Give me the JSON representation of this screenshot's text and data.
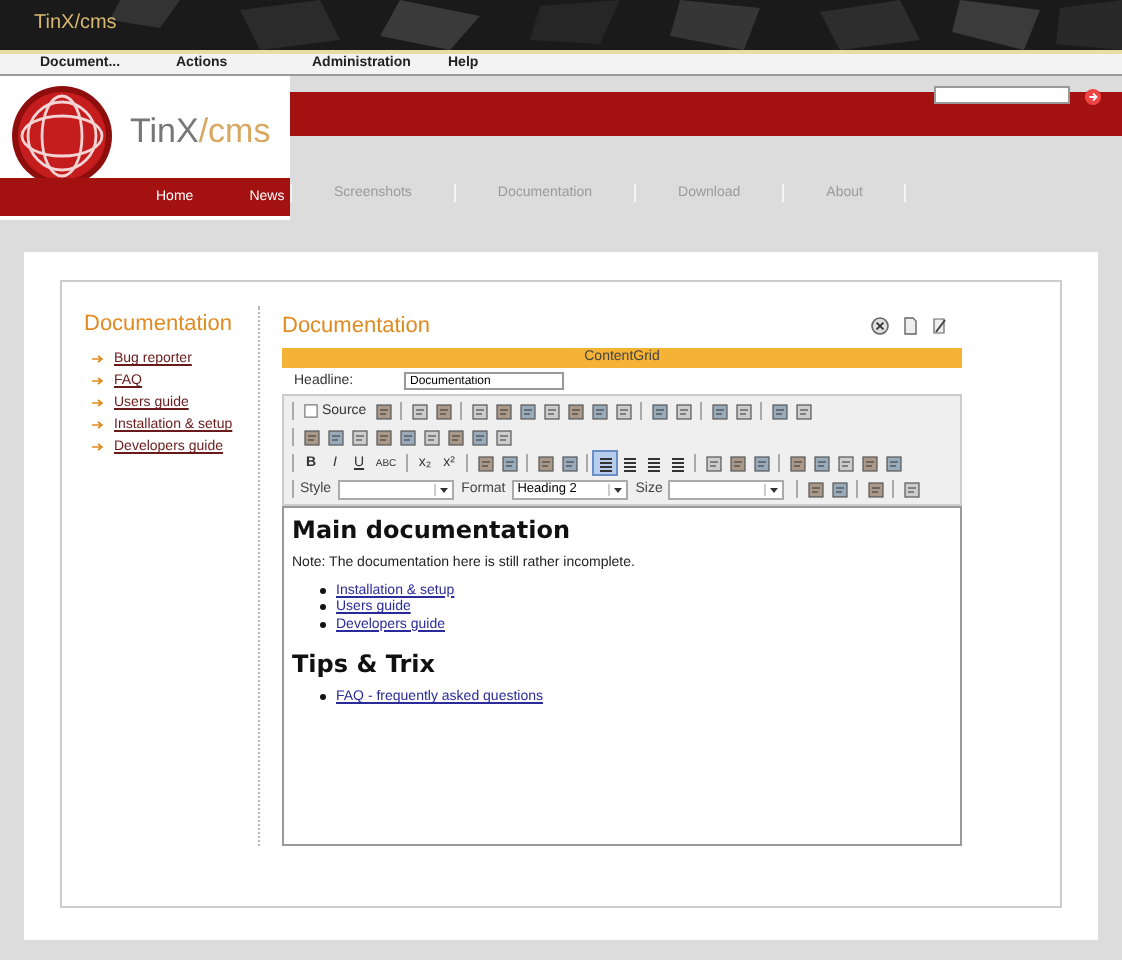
{
  "banner": {
    "title_a": "TinX",
    "title_b": "/cms"
  },
  "menu": [
    "Document...",
    "Actions",
    "Administration",
    "Help"
  ],
  "logo": {
    "text_a": "TinX",
    "text_b": "/cms"
  },
  "nav_left": [
    "Home",
    "News"
  ],
  "nav_right": [
    "Screenshots",
    "Documentation",
    "Download",
    "About"
  ],
  "sidebar": {
    "title": "Documentation",
    "links": [
      "Bug reporter",
      "FAQ",
      "Users guide",
      "Installation & setup",
      "Developers guide"
    ]
  },
  "main": {
    "title": "Documentation",
    "grid_title": "ContentGrid",
    "headline_label": "Headline:",
    "headline_value": "Documentation",
    "toolbar": [
      [
        {
          "kind": "sep"
        },
        {
          "kind": "text",
          "label": "Source"
        },
        {
          "kind": "icon"
        },
        {
          "kind": "sep"
        },
        {
          "kind": "icon"
        },
        {
          "kind": "icon"
        },
        {
          "kind": "sep"
        },
        {
          "kind": "icon"
        },
        {
          "kind": "icon"
        },
        {
          "kind": "icon"
        },
        {
          "kind": "icon"
        },
        {
          "kind": "icon"
        },
        {
          "kind": "icon"
        },
        {
          "kind": "icon"
        },
        {
          "kind": "sep"
        },
        {
          "kind": "icon"
        },
        {
          "kind": "icon"
        },
        {
          "kind": "sep"
        },
        {
          "kind": "icon"
        },
        {
          "kind": "icon"
        },
        {
          "kind": "sep"
        },
        {
          "kind": "icon"
        },
        {
          "kind": "icon"
        }
      ],
      [
        {
          "kind": "sep"
        },
        {
          "kind": "icon"
        },
        {
          "kind": "icon"
        },
        {
          "kind": "icon"
        },
        {
          "kind": "icon"
        },
        {
          "kind": "icon"
        },
        {
          "kind": "icon"
        },
        {
          "kind": "icon"
        },
        {
          "kind": "icon"
        },
        {
          "kind": "icon"
        }
      ],
      [
        {
          "kind": "sep"
        },
        {
          "kind": "bold",
          "label": "B"
        },
        {
          "kind": "italic",
          "label": "I"
        },
        {
          "kind": "underline",
          "label": "U"
        },
        {
          "kind": "strike",
          "label": "ABC"
        },
        {
          "kind": "sep"
        },
        {
          "kind": "plain",
          "label": "x₂"
        },
        {
          "kind": "plain",
          "label": "x²"
        },
        {
          "kind": "sep"
        },
        {
          "kind": "icon"
        },
        {
          "kind": "icon"
        },
        {
          "kind": "sep"
        },
        {
          "kind": "icon"
        },
        {
          "kind": "icon"
        },
        {
          "kind": "sep"
        },
        {
          "kind": "align",
          "selected": true
        },
        {
          "kind": "align",
          "selected": false
        },
        {
          "kind": "align",
          "selected": false
        },
        {
          "kind": "align",
          "selected": false
        },
        {
          "kind": "sep"
        },
        {
          "kind": "icon"
        },
        {
          "kind": "icon"
        },
        {
          "kind": "icon"
        },
        {
          "kind": "sep"
        },
        {
          "kind": "icon"
        },
        {
          "kind": "icon"
        },
        {
          "kind": "icon"
        },
        {
          "kind": "icon"
        },
        {
          "kind": "icon"
        }
      ],
      [
        {
          "kind": "sep"
        },
        {
          "kind": "select",
          "label": "Style"
        },
        {
          "kind": "select",
          "label": "Format",
          "value": "Heading 2"
        },
        {
          "kind": "select",
          "label": "Size"
        },
        {
          "kind": "sep"
        },
        {
          "kind": "icon"
        },
        {
          "kind": "icon"
        },
        {
          "kind": "sep"
        },
        {
          "kind": "icon"
        },
        {
          "kind": "sep"
        },
        {
          "kind": "icon"
        }
      ]
    ],
    "content": [
      {
        "kind": "heading",
        "text": "Main documentation"
      },
      {
        "kind": "para",
        "text": "Note: The documentation here is still rather incomplete."
      },
      {
        "kind": "list",
        "items": [
          "Installation & setup",
          "Users guide",
          "Developers guide"
        ]
      },
      {
        "kind": "heading",
        "text": "Tips & Trix"
      },
      {
        "kind": "list",
        "items": [
          "FAQ - frequently asked questions"
        ]
      }
    ]
  }
}
